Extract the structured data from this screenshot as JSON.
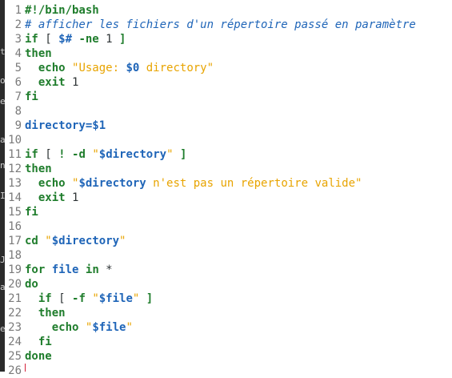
{
  "editor": {
    "lines": [
      [
        {
          "t": "#!/bin/bash",
          "c": "kw"
        }
      ],
      [
        {
          "t": "# afficher les fichiers d'un répertoire passé en paramètre",
          "c": "com"
        }
      ],
      [
        {
          "t": "if",
          "c": "kw"
        },
        {
          "t": " [ ",
          "c": "op"
        },
        {
          "t": "$#",
          "c": "var"
        },
        {
          "t": " ",
          "c": "op"
        },
        {
          "t": "-ne",
          "c": "kw"
        },
        {
          "t": " 1 ",
          "c": "op"
        },
        {
          "t": "]",
          "c": "kw"
        }
      ],
      [
        {
          "t": "then",
          "c": "kw"
        }
      ],
      [
        {
          "t": "  ",
          "c": "op"
        },
        {
          "t": "echo",
          "c": "bi"
        },
        {
          "t": " ",
          "c": "op"
        },
        {
          "t": "\"Usage: ",
          "c": "str"
        },
        {
          "t": "$0",
          "c": "var"
        },
        {
          "t": " directory\"",
          "c": "str"
        }
      ],
      [
        {
          "t": "  ",
          "c": "op"
        },
        {
          "t": "exit",
          "c": "bi"
        },
        {
          "t": " 1",
          "c": "op"
        }
      ],
      [
        {
          "t": "fi",
          "c": "kw"
        }
      ],
      [],
      [
        {
          "t": "directory=",
          "c": "var"
        },
        {
          "t": "$1",
          "c": "var"
        }
      ],
      [],
      [
        {
          "t": "if",
          "c": "kw"
        },
        {
          "t": " [ ",
          "c": "op"
        },
        {
          "t": "!",
          "c": "kw"
        },
        {
          "t": " ",
          "c": "op"
        },
        {
          "t": "-d",
          "c": "kw"
        },
        {
          "t": " ",
          "c": "op"
        },
        {
          "t": "\"",
          "c": "str"
        },
        {
          "t": "$directory",
          "c": "var"
        },
        {
          "t": "\"",
          "c": "str"
        },
        {
          "t": " ",
          "c": "op"
        },
        {
          "t": "]",
          "c": "kw"
        }
      ],
      [
        {
          "t": "then",
          "c": "kw"
        }
      ],
      [
        {
          "t": "  ",
          "c": "op"
        },
        {
          "t": "echo",
          "c": "bi"
        },
        {
          "t": " ",
          "c": "op"
        },
        {
          "t": "\"",
          "c": "str"
        },
        {
          "t": "$directory",
          "c": "var"
        },
        {
          "t": " n'est pas un répertoire valide\"",
          "c": "str"
        }
      ],
      [
        {
          "t": "  ",
          "c": "op"
        },
        {
          "t": "exit",
          "c": "bi"
        },
        {
          "t": " 1",
          "c": "op"
        }
      ],
      [
        {
          "t": "fi",
          "c": "kw"
        }
      ],
      [],
      [
        {
          "t": "cd",
          "c": "bi"
        },
        {
          "t": " ",
          "c": "op"
        },
        {
          "t": "\"",
          "c": "str"
        },
        {
          "t": "$directory",
          "c": "var"
        },
        {
          "t": "\"",
          "c": "str"
        }
      ],
      [],
      [
        {
          "t": "for",
          "c": "kw"
        },
        {
          "t": " ",
          "c": "op"
        },
        {
          "t": "file",
          "c": "var"
        },
        {
          "t": " ",
          "c": "op"
        },
        {
          "t": "in",
          "c": "kw"
        },
        {
          "t": " *",
          "c": "op"
        }
      ],
      [
        {
          "t": "do",
          "c": "kw"
        }
      ],
      [
        {
          "t": "  ",
          "c": "op"
        },
        {
          "t": "if",
          "c": "kw"
        },
        {
          "t": " [ ",
          "c": "op"
        },
        {
          "t": "-f",
          "c": "kw"
        },
        {
          "t": " ",
          "c": "op"
        },
        {
          "t": "\"",
          "c": "str"
        },
        {
          "t": "$file",
          "c": "var"
        },
        {
          "t": "\"",
          "c": "str"
        },
        {
          "t": " ",
          "c": "op"
        },
        {
          "t": "]",
          "c": "kw"
        }
      ],
      [
        {
          "t": "  ",
          "c": "op"
        },
        {
          "t": "then",
          "c": "kw"
        }
      ],
      [
        {
          "t": "    ",
          "c": "op"
        },
        {
          "t": "echo",
          "c": "bi"
        },
        {
          "t": " ",
          "c": "op"
        },
        {
          "t": "\"",
          "c": "str"
        },
        {
          "t": "$file",
          "c": "var"
        },
        {
          "t": "\"",
          "c": "str"
        }
      ],
      [
        {
          "t": "  ",
          "c": "op"
        },
        {
          "t": "fi",
          "c": "kw"
        }
      ],
      [
        {
          "t": "done",
          "c": "kw"
        }
      ],
      []
    ]
  },
  "left_strip_marks": [
    "t",
    "o",
    "e",
    "a",
    "n",
    "I",
    "J",
    "a",
    "e"
  ],
  "colors": {
    "keyword": "#1f7d2c",
    "variable": "#1f65b8",
    "string": "#e8a400",
    "comment": "#1f65b8",
    "line_number": "#7a7a7a",
    "cursor": "#d3203a"
  }
}
